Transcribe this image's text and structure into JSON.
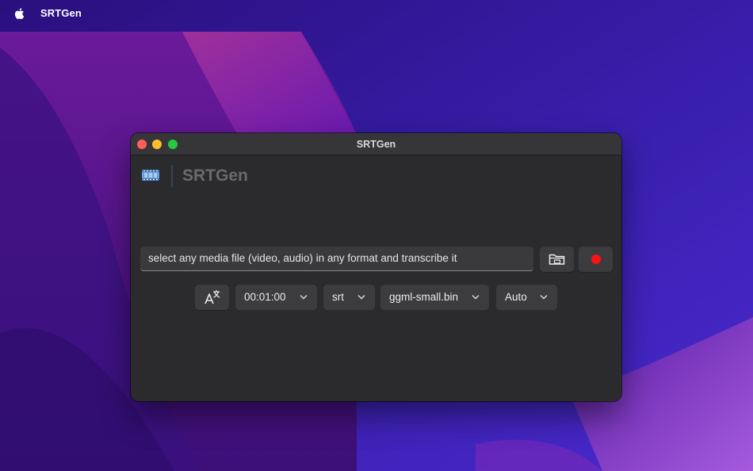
{
  "menubar": {
    "apple_icon": "apple-logo-icon",
    "app_name": "SRTGen"
  },
  "window": {
    "title": "SRTGen",
    "brand": {
      "icon": "film-strip-icon",
      "name": "SRTGen"
    },
    "file_input": {
      "placeholder": "select any media file (video, audio) in any format and transcribe it",
      "value": ""
    },
    "buttons": {
      "open_icon": "folder-icon",
      "record_icon": "record-icon",
      "record_color": "#fe1212",
      "translate_icon": "translate-icon"
    },
    "selects": {
      "duration": "00:01:00",
      "format": "srt",
      "model": "ggml-small.bin",
      "language": "Auto"
    }
  }
}
